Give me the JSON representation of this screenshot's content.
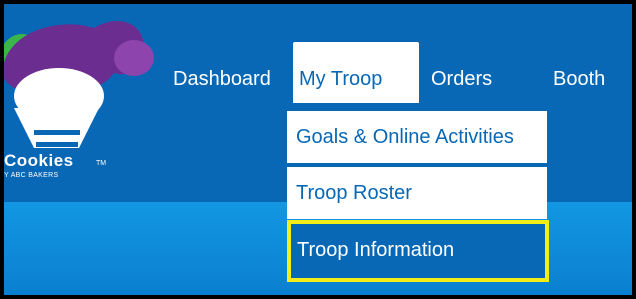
{
  "logo": {
    "text": "Cookies",
    "tm": "TM",
    "sub": "Y ABC BAKERS"
  },
  "nav": {
    "items": [
      {
        "label": "Dashboard"
      },
      {
        "label": "My Troop"
      },
      {
        "label": "Orders"
      },
      {
        "label": "Booth"
      }
    ],
    "active": "My Troop"
  },
  "dropdown": {
    "items": [
      {
        "label": "Goals & Online Activities"
      },
      {
        "label": "Troop Roster"
      },
      {
        "label": "Troop Information"
      }
    ],
    "highlighted": "Troop Information"
  },
  "colors": {
    "header": "#0868b5",
    "accent_highlight": "#f3ed1a",
    "lower_band": "#1297e2"
  }
}
